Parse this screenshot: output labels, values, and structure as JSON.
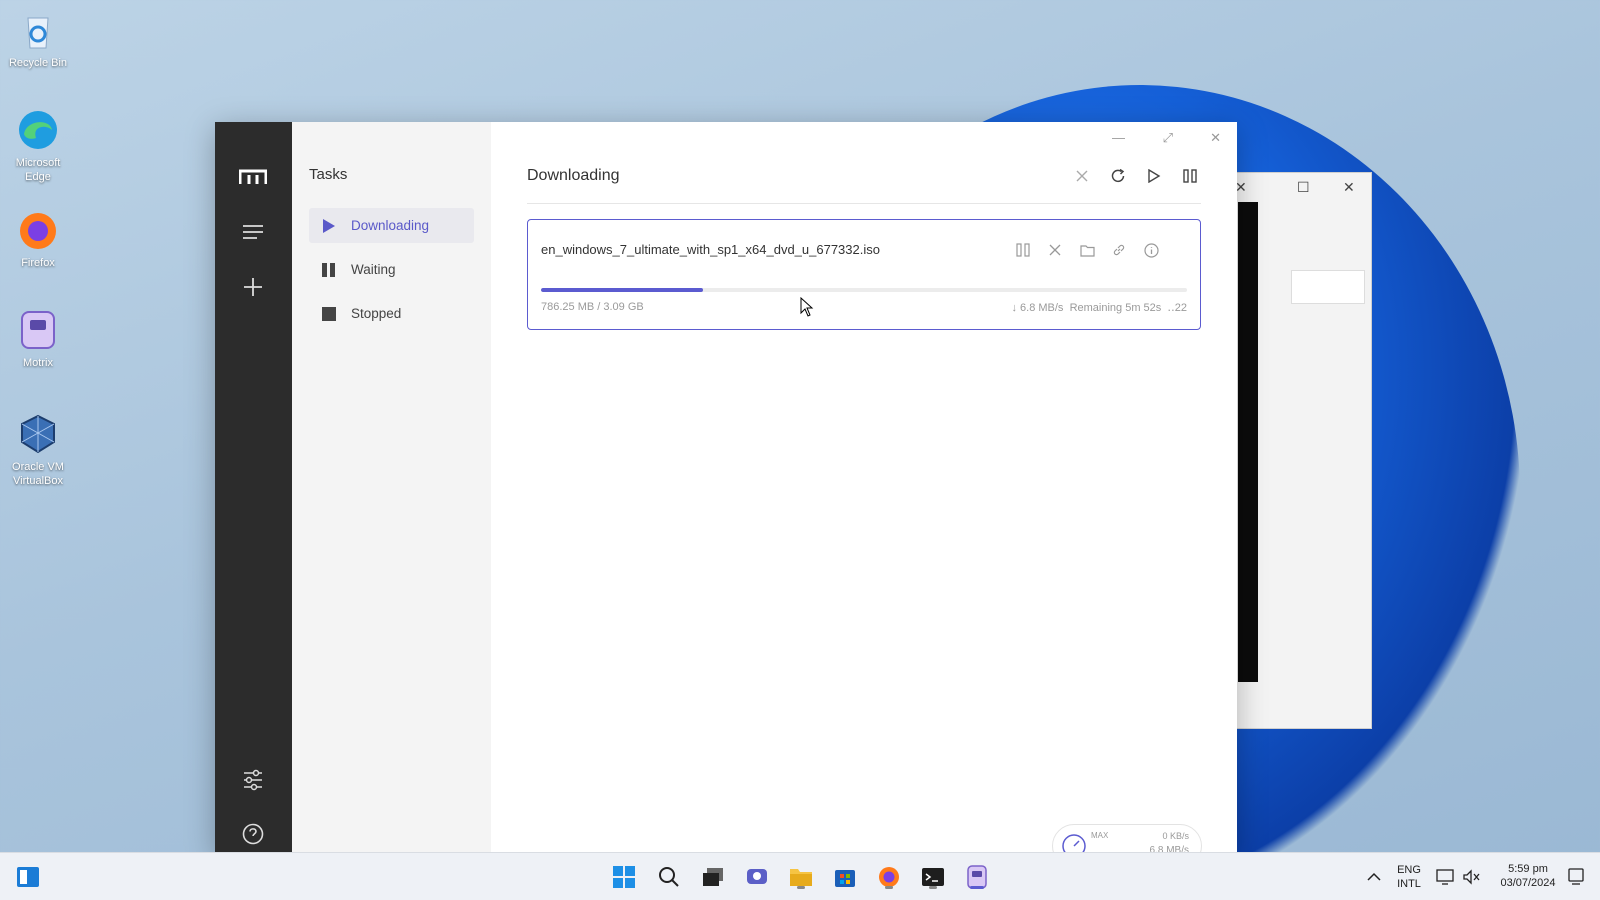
{
  "desktop": {
    "icons": [
      {
        "label": "Recycle Bin",
        "icon": "recycle-bin-icon"
      },
      {
        "label": "Microsoft Edge",
        "icon": "edge-icon"
      },
      {
        "label": "Firefox",
        "icon": "firefox-icon"
      },
      {
        "label": "Motrix",
        "icon": "motrix-icon"
      },
      {
        "label": "Oracle VM VirtualBox",
        "icon": "virtualbox-icon"
      }
    ]
  },
  "app": {
    "name": "Motrix",
    "window_controls": {
      "minimize": "—",
      "maximize": "⤢",
      "close": "✕"
    },
    "rail": {
      "logo": "m-logo-icon",
      "menu": "menu-icon",
      "add": "plus-icon",
      "settings": "sliders-icon",
      "help": "help-icon"
    },
    "sidebar": {
      "title": "Tasks",
      "items": [
        {
          "label": "Downloading",
          "icon": "play-icon",
          "active": true
        },
        {
          "label": "Waiting",
          "icon": "pause-icon",
          "active": false
        },
        {
          "label": "Stopped",
          "icon": "stop-icon",
          "active": false
        }
      ]
    },
    "main": {
      "title": "Downloading",
      "actions": [
        "close-icon",
        "refresh-icon",
        "play-icon",
        "pause-icon"
      ]
    },
    "task": {
      "filename": "en_windows_7_ultimate_with_sp1_x64_dvd_u_677332.iso",
      "progress": 0.25,
      "size": "786.25 MB / 3.09 GB",
      "speed": "↓ 6.8 MB/s",
      "remaining": "Remaining 5m 52s",
      "connections": "22",
      "actions": [
        "pause-icon",
        "delete-icon",
        "folder-icon",
        "link-icon",
        "info-icon"
      ]
    },
    "speedometer": {
      "max_label": "MAX",
      "upload": "0 KB/s",
      "download": "6.8 MB/s"
    }
  },
  "taskbar": {
    "apps": [
      "start-icon",
      "search-icon",
      "task-view-icon",
      "chat-icon",
      "file-explorer-icon",
      "store-icon",
      "firefox-icon",
      "terminal-icon",
      "motrix-icon"
    ],
    "tray": {
      "lang_line1": "ENG",
      "lang_line2": "INTL",
      "time": "5:59 pm",
      "date": "03/07/2024"
    }
  },
  "colors": {
    "accent": "#5b5bd0",
    "rail": "#2c2c2c"
  }
}
